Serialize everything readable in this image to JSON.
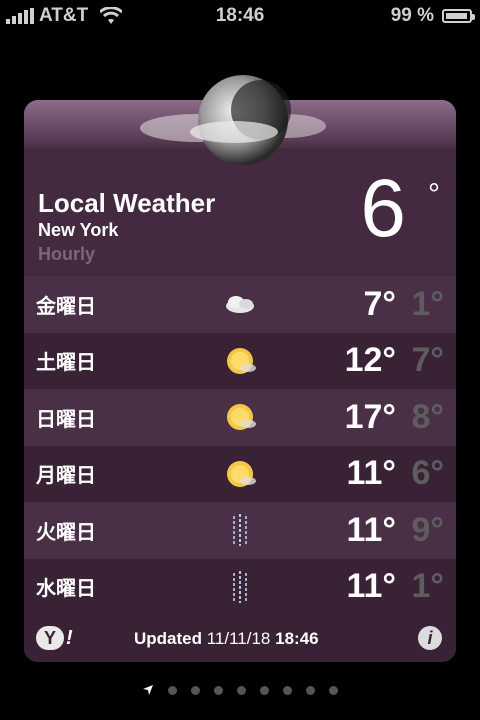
{
  "status_bar": {
    "carrier": "AT&T",
    "time": "18:46",
    "battery_text": "99 %",
    "battery_level": 0.99
  },
  "weather": {
    "title": "Local Weather",
    "city": "New York",
    "mode": "Hourly",
    "current_temp": "6",
    "degree_symbol": "°",
    "forecast": [
      {
        "day": "金曜日",
        "icon": "partly-cloudy-night-icon",
        "high": "7°",
        "low": "1°"
      },
      {
        "day": "土曜日",
        "icon": "sunny-icon",
        "high": "12°",
        "low": "7°"
      },
      {
        "day": "日曜日",
        "icon": "sunny-icon",
        "high": "17°",
        "low": "8°"
      },
      {
        "day": "月曜日",
        "icon": "sunny-icon",
        "high": "11°",
        "low": "6°"
      },
      {
        "day": "火曜日",
        "icon": "rain-icon",
        "high": "11°",
        "low": "9°"
      },
      {
        "day": "水曜日",
        "icon": "rain-icon",
        "high": "11°",
        "low": "1°"
      }
    ]
  },
  "footer": {
    "yahoo_label": "Y",
    "yahoo_excl": "!",
    "updated_label": "Updated",
    "updated_date": "11/11/18",
    "updated_time": "18:46",
    "info_label": "i"
  },
  "pager": {
    "dot_count": 8,
    "location_icon": "location-arrow-icon"
  }
}
